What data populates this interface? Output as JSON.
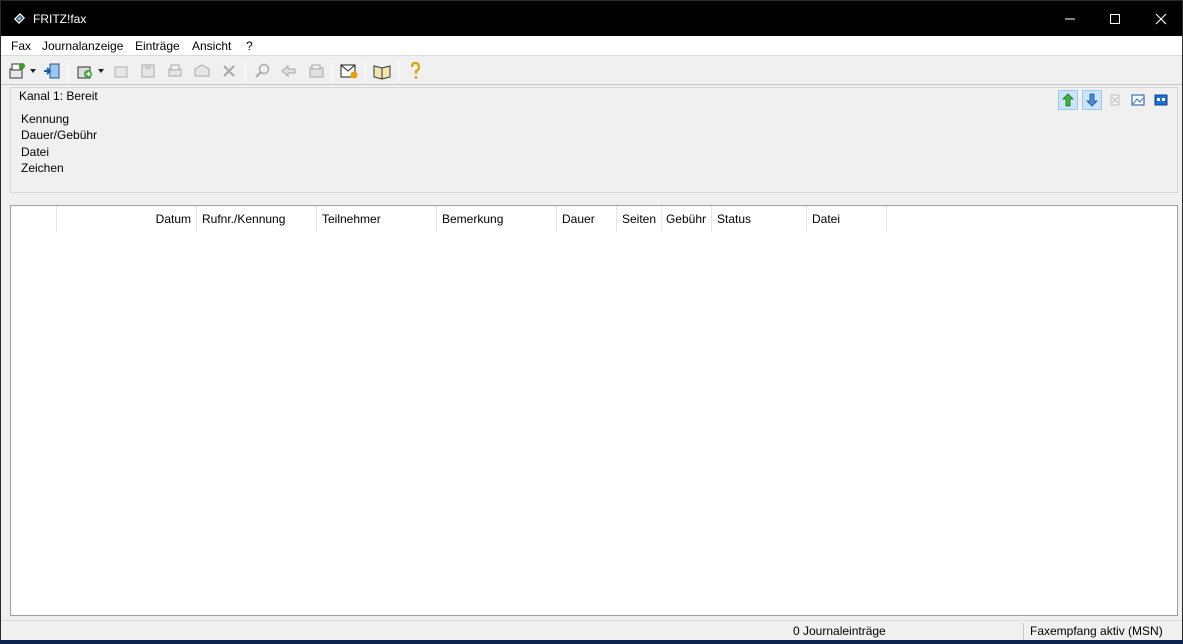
{
  "window": {
    "title": "FRITZ!fax"
  },
  "menu": [
    {
      "label": "Fax"
    },
    {
      "label": "Journalanzeige"
    },
    {
      "label": "Einträge"
    },
    {
      "label": "Ansicht"
    },
    {
      "label": "?"
    }
  ],
  "toolbar": {
    "icons": [
      "new-fax-icon",
      "import-icon",
      "send-icon",
      "forward-icon",
      "save-icon",
      "print-icon",
      "archive-icon",
      "delete-icon",
      "search-icon",
      "reply-icon",
      "fax-machine-icon",
      "fax-inbox-icon",
      "phonebook-icon",
      "help-icon"
    ]
  },
  "channel": {
    "status": "Kanal 1: Bereit",
    "fields": [
      "Kennung",
      "Dauer/Gebühr",
      "Datei",
      "Zeichen"
    ]
  },
  "journal": {
    "columns": [
      "Datum",
      "Rufnr./Kennung",
      "Teilnehmer",
      "Bemerkung",
      "Dauer",
      "Seiten",
      "Gebühr",
      "Status",
      "Datei"
    ],
    "rows": []
  },
  "statusbar": {
    "entries": "0 Journaleinträge",
    "mode": "Faxempfang aktiv (MSN)"
  },
  "colors": {
    "titlebar": "#000000",
    "window_bg": "#f0f0f0",
    "pressed_btn": "#cce4f7"
  }
}
